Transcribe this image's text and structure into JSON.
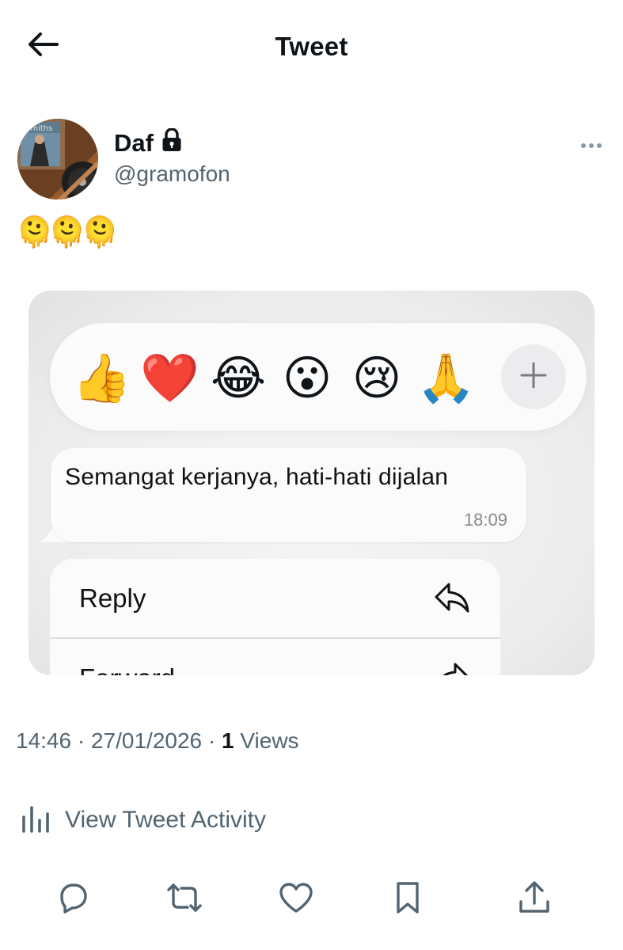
{
  "header": {
    "title": "Tweet",
    "back_icon": "arrow-left-icon"
  },
  "author": {
    "name": "Daf",
    "handle": "@gramofon",
    "protected_icon": "lock-icon",
    "avatar_label": "Smiths",
    "more_icon": "more-horizontal-icon"
  },
  "tweet": {
    "text": "🫠🫠🫠"
  },
  "media": {
    "reactions": [
      "👍",
      "❤️",
      "😂",
      "😮",
      "😢",
      "🙏"
    ],
    "add_reaction_icon": "plus-icon",
    "message": {
      "text": "Semangat kerjanya, hati-hati dijalan",
      "time": "18:09"
    },
    "menu": [
      {
        "label": "Reply",
        "icon": "reply-icon"
      },
      {
        "label": "Forward",
        "icon": "forward-icon"
      }
    ]
  },
  "meta": {
    "time": "14:46",
    "sep1": "·",
    "date": "27/01/2026",
    "sep2": "·",
    "views_count": "1",
    "views_label": "Views"
  },
  "activity": {
    "label": "View Tweet Activity",
    "icon": "bar-chart-icon"
  },
  "actions": [
    {
      "name": "reply",
      "icon": "comment-icon"
    },
    {
      "name": "retweet",
      "icon": "retweet-icon"
    },
    {
      "name": "like",
      "icon": "heart-icon"
    },
    {
      "name": "bookmark",
      "icon": "bookmark-icon"
    },
    {
      "name": "share",
      "icon": "share-icon"
    }
  ],
  "colors": {
    "text_primary": "#0f1419",
    "text_secondary": "#536471",
    "heart": "#e0282e"
  }
}
